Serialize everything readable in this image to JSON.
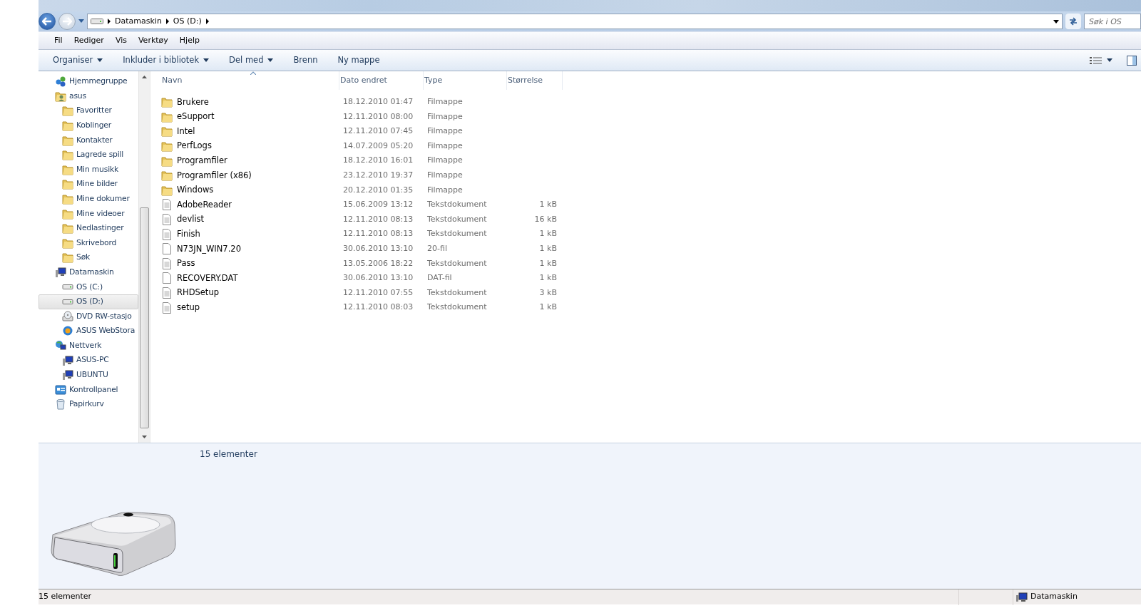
{
  "address_bar": {
    "breadcrumbs": [
      "Datamaskin",
      "OS (D:)"
    ]
  },
  "search": {
    "placeholder": "Søk i OS"
  },
  "menu_bar": [
    "Fil",
    "Rediger",
    "Vis",
    "Verktøy",
    "Hjelp"
  ],
  "command_bar": [
    {
      "label": "Organiser",
      "dropdown": true
    },
    {
      "label": "Inkluder i bibliotek",
      "dropdown": true
    },
    {
      "label": "Del med",
      "dropdown": true
    },
    {
      "label": "Brenn",
      "dropdown": false
    },
    {
      "label": "Ny mappe",
      "dropdown": false
    }
  ],
  "navigation_pane": {
    "items": [
      {
        "label": "Hjemmegruppe",
        "kind": "homegroup",
        "selected": false
      },
      {
        "label": "asus",
        "kind": "user",
        "selected": false,
        "children": [
          {
            "label": "Favoritter",
            "kind": "folder",
            "selected": false
          },
          {
            "label": "Koblinger",
            "kind": "folder",
            "selected": false
          },
          {
            "label": "Kontakter",
            "kind": "folder",
            "selected": false
          },
          {
            "label": "Lagrede spill",
            "kind": "folder",
            "selected": false
          },
          {
            "label": "Min musikk",
            "kind": "folder",
            "selected": false
          },
          {
            "label": "Mine bilder",
            "kind": "folder",
            "selected": false
          },
          {
            "label": "Mine dokumer",
            "kind": "folder",
            "selected": false
          },
          {
            "label": "Mine videoer",
            "kind": "folder",
            "selected": false
          },
          {
            "label": "Nedlastinger",
            "kind": "folder",
            "selected": false
          },
          {
            "label": "Skrivebord",
            "kind": "folder",
            "selected": false
          },
          {
            "label": "Søk",
            "kind": "folder",
            "selected": false
          }
        ]
      },
      {
        "label": "Datamaskin",
        "kind": "computer",
        "selected": false,
        "children": [
          {
            "label": "OS (C:)",
            "kind": "drive",
            "selected": false
          },
          {
            "label": "OS (D:)",
            "kind": "drive",
            "selected": true
          },
          {
            "label": "DVD RW-stasjo",
            "kind": "disc",
            "selected": false
          },
          {
            "label": "ASUS WebStora",
            "kind": "cloud",
            "selected": false
          }
        ]
      },
      {
        "label": "Nettverk",
        "kind": "network",
        "selected": false,
        "children": [
          {
            "label": "ASUS-PC",
            "kind": "computer",
            "selected": false
          },
          {
            "label": "UBUNTU",
            "kind": "computer",
            "selected": false
          }
        ]
      },
      {
        "label": "Kontrollpanel",
        "kind": "panel",
        "selected": false
      },
      {
        "label": "Papirkurv",
        "kind": "bin",
        "selected": false
      }
    ]
  },
  "file_list": {
    "columns": [
      {
        "label": "Navn",
        "sorted": true
      },
      {
        "label": "Dato endret",
        "sorted": false
      },
      {
        "label": "Type",
        "sorted": false
      },
      {
        "label": "Størrelse",
        "sorted": false
      }
    ],
    "rows": [
      {
        "name": "Brukere",
        "date": "18.12.2010 01:47",
        "type": "Filmappe",
        "kind": "folder"
      },
      {
        "name": "eSupport",
        "date": "12.11.2010 08:00",
        "type": "Filmappe",
        "kind": "folder"
      },
      {
        "name": "Intel",
        "date": "12.11.2010 07:45",
        "type": "Filmappe",
        "kind": "folder"
      },
      {
        "name": "PerfLogs",
        "date": "14.07.2009 05:20",
        "type": "Filmappe",
        "kind": "folder"
      },
      {
        "name": "Programfiler",
        "date": "18.12.2010 16:01",
        "type": "Filmappe",
        "kind": "folder"
      },
      {
        "name": "Programfiler (x86)",
        "date": "23.12.2010 19:37",
        "type": "Filmappe",
        "kind": "folder"
      },
      {
        "name": "Windows",
        "date": "20.12.2010 01:35",
        "type": "Filmappe",
        "kind": "folder"
      },
      {
        "name": "AdobeReader",
        "date": "15.06.2009 13:12",
        "type": "Tekstdokument",
        "size": "1 kB",
        "kind": "text"
      },
      {
        "name": "devlist",
        "date": "12.11.2010 08:13",
        "type": "Tekstdokument",
        "size": "16 kB",
        "kind": "text"
      },
      {
        "name": "Finish",
        "date": "12.11.2010 08:13",
        "type": "Tekstdokument",
        "size": "1 kB",
        "kind": "text"
      },
      {
        "name": "N73JN_WIN7.20",
        "date": "30.06.2010 13:10",
        "type": "20-fil",
        "size": "1 kB",
        "kind": "blank"
      },
      {
        "name": "Pass",
        "date": "13.05.2006 18:22",
        "type": "Tekstdokument",
        "size": "1 kB",
        "kind": "text"
      },
      {
        "name": "RECOVERY.DAT",
        "date": "30.06.2010 13:10",
        "type": "DAT-fil",
        "size": "1 kB",
        "kind": "blank"
      },
      {
        "name": "RHDSetup",
        "date": "12.11.2010 07:55",
        "type": "Tekstdokument",
        "size": "3 kB",
        "kind": "text"
      },
      {
        "name": "setup",
        "date": "12.11.2010 08:03",
        "type": "Tekstdokument",
        "size": "1 kB",
        "kind": "text"
      }
    ]
  },
  "details_pane": {
    "summary": "15 elementer"
  },
  "status_bar": {
    "left": "15 elementer",
    "location": "Datamaskin"
  }
}
